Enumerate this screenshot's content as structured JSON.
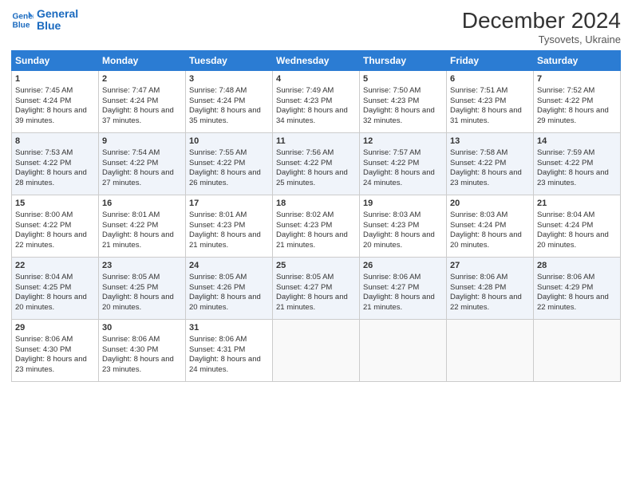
{
  "header": {
    "logo_line1": "General",
    "logo_line2": "Blue",
    "month": "December 2024",
    "location": "Tysovets, Ukraine"
  },
  "days_of_week": [
    "Sunday",
    "Monday",
    "Tuesday",
    "Wednesday",
    "Thursday",
    "Friday",
    "Saturday"
  ],
  "weeks": [
    [
      {
        "day": 1,
        "sunrise": "7:45 AM",
        "sunset": "4:24 PM",
        "daylight": "8 hours and 39 minutes."
      },
      {
        "day": 2,
        "sunrise": "7:47 AM",
        "sunset": "4:24 PM",
        "daylight": "8 hours and 37 minutes."
      },
      {
        "day": 3,
        "sunrise": "7:48 AM",
        "sunset": "4:24 PM",
        "daylight": "8 hours and 35 minutes."
      },
      {
        "day": 4,
        "sunrise": "7:49 AM",
        "sunset": "4:23 PM",
        "daylight": "8 hours and 34 minutes."
      },
      {
        "day": 5,
        "sunrise": "7:50 AM",
        "sunset": "4:23 PM",
        "daylight": "8 hours and 32 minutes."
      },
      {
        "day": 6,
        "sunrise": "7:51 AM",
        "sunset": "4:23 PM",
        "daylight": "8 hours and 31 minutes."
      },
      {
        "day": 7,
        "sunrise": "7:52 AM",
        "sunset": "4:22 PM",
        "daylight": "8 hours and 29 minutes."
      }
    ],
    [
      {
        "day": 8,
        "sunrise": "7:53 AM",
        "sunset": "4:22 PM",
        "daylight": "8 hours and 28 minutes."
      },
      {
        "day": 9,
        "sunrise": "7:54 AM",
        "sunset": "4:22 PM",
        "daylight": "8 hours and 27 minutes."
      },
      {
        "day": 10,
        "sunrise": "7:55 AM",
        "sunset": "4:22 PM",
        "daylight": "8 hours and 26 minutes."
      },
      {
        "day": 11,
        "sunrise": "7:56 AM",
        "sunset": "4:22 PM",
        "daylight": "8 hours and 25 minutes."
      },
      {
        "day": 12,
        "sunrise": "7:57 AM",
        "sunset": "4:22 PM",
        "daylight": "8 hours and 24 minutes."
      },
      {
        "day": 13,
        "sunrise": "7:58 AM",
        "sunset": "4:22 PM",
        "daylight": "8 hours and 23 minutes."
      },
      {
        "day": 14,
        "sunrise": "7:59 AM",
        "sunset": "4:22 PM",
        "daylight": "8 hours and 23 minutes."
      }
    ],
    [
      {
        "day": 15,
        "sunrise": "8:00 AM",
        "sunset": "4:22 PM",
        "daylight": "8 hours and 22 minutes."
      },
      {
        "day": 16,
        "sunrise": "8:01 AM",
        "sunset": "4:22 PM",
        "daylight": "8 hours and 21 minutes."
      },
      {
        "day": 17,
        "sunrise": "8:01 AM",
        "sunset": "4:23 PM",
        "daylight": "8 hours and 21 minutes."
      },
      {
        "day": 18,
        "sunrise": "8:02 AM",
        "sunset": "4:23 PM",
        "daylight": "8 hours and 21 minutes."
      },
      {
        "day": 19,
        "sunrise": "8:03 AM",
        "sunset": "4:23 PM",
        "daylight": "8 hours and 20 minutes."
      },
      {
        "day": 20,
        "sunrise": "8:03 AM",
        "sunset": "4:24 PM",
        "daylight": "8 hours and 20 minutes."
      },
      {
        "day": 21,
        "sunrise": "8:04 AM",
        "sunset": "4:24 PM",
        "daylight": "8 hours and 20 minutes."
      }
    ],
    [
      {
        "day": 22,
        "sunrise": "8:04 AM",
        "sunset": "4:25 PM",
        "daylight": "8 hours and 20 minutes."
      },
      {
        "day": 23,
        "sunrise": "8:05 AM",
        "sunset": "4:25 PM",
        "daylight": "8 hours and 20 minutes."
      },
      {
        "day": 24,
        "sunrise": "8:05 AM",
        "sunset": "4:26 PM",
        "daylight": "8 hours and 20 minutes."
      },
      {
        "day": 25,
        "sunrise": "8:05 AM",
        "sunset": "4:27 PM",
        "daylight": "8 hours and 21 minutes."
      },
      {
        "day": 26,
        "sunrise": "8:06 AM",
        "sunset": "4:27 PM",
        "daylight": "8 hours and 21 minutes."
      },
      {
        "day": 27,
        "sunrise": "8:06 AM",
        "sunset": "4:28 PM",
        "daylight": "8 hours and 22 minutes."
      },
      {
        "day": 28,
        "sunrise": "8:06 AM",
        "sunset": "4:29 PM",
        "daylight": "8 hours and 22 minutes."
      }
    ],
    [
      {
        "day": 29,
        "sunrise": "8:06 AM",
        "sunset": "4:30 PM",
        "daylight": "8 hours and 23 minutes."
      },
      {
        "day": 30,
        "sunrise": "8:06 AM",
        "sunset": "4:30 PM",
        "daylight": "8 hours and 23 minutes."
      },
      {
        "day": 31,
        "sunrise": "8:06 AM",
        "sunset": "4:31 PM",
        "daylight": "8 hours and 24 minutes."
      },
      null,
      null,
      null,
      null
    ]
  ]
}
